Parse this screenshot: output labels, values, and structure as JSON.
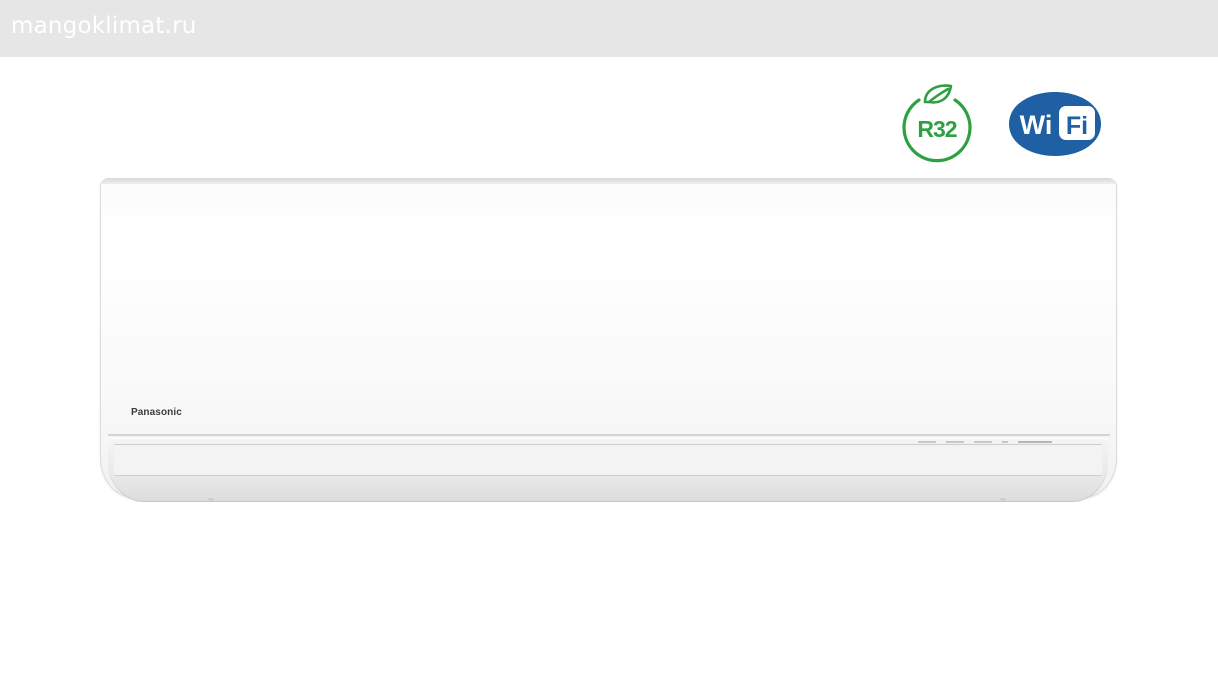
{
  "header": {
    "site_name": "mangoklimat.ru"
  },
  "badges": {
    "refrigerant": {
      "label": "R32",
      "icon": "leaf-icon",
      "color": "#2ea043"
    },
    "wifi": {
      "label_left": "Wi",
      "label_right": "Fi",
      "color": "#1f5fa3"
    }
  },
  "product": {
    "brand": "Panasonic",
    "type": "wall-mounted air conditioner indoor unit"
  }
}
